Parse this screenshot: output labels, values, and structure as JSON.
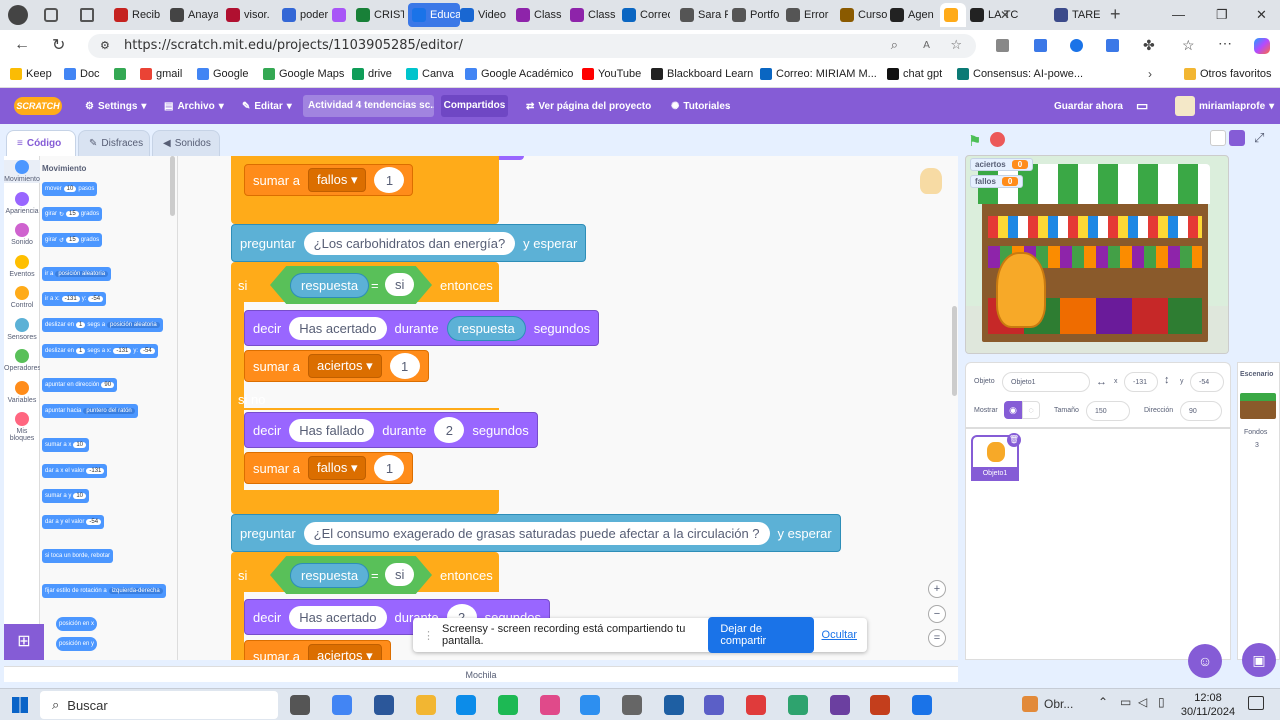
{
  "browser": {
    "tabs": [
      {
        "label": "Recib",
        "color": "#c5221f"
      },
      {
        "label": "Anaya",
        "color": "#444444"
      },
      {
        "label": "visor.",
        "color": "#b01030"
      },
      {
        "label": "poder",
        "color": "#3367d6"
      },
      {
        "label": "",
        "color": "#a855f7"
      },
      {
        "label": "CRIST",
        "color": "#188038"
      },
      {
        "label": "Educal",
        "color": "#1a73e8"
      },
      {
        "label": "Video",
        "color": "#1967d2"
      },
      {
        "label": "Class",
        "color": "#8e24aa"
      },
      {
        "label": "Class",
        "color": "#8e24aa"
      },
      {
        "label": "Correo",
        "color": "#0a66c2"
      },
      {
        "label": "Sara F",
        "color": "#555555"
      },
      {
        "label": "Portfo",
        "color": "#555555"
      },
      {
        "label": "Error",
        "color": "#555555"
      },
      {
        "label": "Curso",
        "color": "#8a5a00"
      },
      {
        "label": "Agen",
        "color": "#222222"
      },
      {
        "label": "",
        "color": "#ffab19"
      },
      {
        "label": "LA TC",
        "color": "#222222"
      },
      {
        "label": "TARE",
        "color": "#3b4a8a"
      }
    ],
    "url": "https://scratch.mit.edu/projects/1103905285/editor/",
    "bookmarks": [
      {
        "label": "Keep",
        "color": "#fbbc04"
      },
      {
        "label": "Doc",
        "color": "#4285f4"
      },
      {
        "label": "",
        "color": "#34a853"
      },
      {
        "label": "gmail",
        "color": "#ea4335"
      },
      {
        "label": "Google",
        "color": "#4285f4"
      },
      {
        "label": "Google Maps",
        "color": "#34a853"
      },
      {
        "label": "drive",
        "color": "#0f9d58"
      },
      {
        "label": "Canva",
        "color": "#00c4cc"
      },
      {
        "label": "Google Académico",
        "color": "#4285f4"
      },
      {
        "label": "YouTube",
        "color": "#ff0000"
      },
      {
        "label": "Blackboard Learn",
        "color": "#222222"
      },
      {
        "label": "Correo: MIRIAM M...",
        "color": "#0a66c2"
      },
      {
        "label": "chat gpt",
        "color": "#111111"
      },
      {
        "label": "Consensus: AI-powe...",
        "color": "#0b7a75"
      }
    ],
    "other_bookmarks": "Otros favoritos"
  },
  "scratch": {
    "menu": {
      "settings": "Settings",
      "file": "Archivo",
      "edit": "Editar",
      "project_title": "Actividad 4 tendencias sc...",
      "shared": "Compartidos",
      "see_project": "Ver página del proyecto",
      "tutorials": "Tutoriales",
      "save": "Guardar ahora",
      "user": "miriamlaprofe",
      "logo": "SCRATCH"
    },
    "tabs": {
      "code": "Código",
      "costumes": "Disfraces",
      "sounds": "Sonidos"
    },
    "categories": [
      {
        "label": "Movimiento",
        "color": "#4c97ff"
      },
      {
        "label": "Apariencia",
        "color": "#9966ff"
      },
      {
        "label": "Sonido",
        "color": "#cf63cf"
      },
      {
        "label": "Eventos",
        "color": "#ffbf00"
      },
      {
        "label": "Control",
        "color": "#ffab19"
      },
      {
        "label": "Sensores",
        "color": "#5cb1d6"
      },
      {
        "label": "Operadores",
        "color": "#59c059"
      },
      {
        "label": "Variables",
        "color": "#ff8c1a"
      },
      {
        "label": "Mis bloques",
        "color": "#ff6680"
      }
    ],
    "palette": {
      "heading": "Movimiento",
      "blocks": {
        "move_a": "mover",
        "move_b": "10",
        "move_c": "pasos",
        "turn_r_a": "girar",
        "turn_r_b": "15",
        "turn_r_c": "grados",
        "turn_l_a": "girar",
        "turn_l_b": "15",
        "turn_l_c": "grados",
        "goto_a": "ir a",
        "goto_b": "posición aleatoria",
        "gotoxy_a": "ir a x:",
        "gotoxy_b": "-131",
        "gotoxy_c": "y:",
        "gotoxy_d": "-54",
        "glide_a": "deslizar en",
        "glide_b": "1",
        "glide_c": "segs a",
        "glide_d": "posición aleatoria",
        "glidexy_a": "deslizar en",
        "glidexy_b": "1",
        "glidexy_c": "segs a x:",
        "glidexy_d": "-131",
        "glidexy_e": "y:",
        "glidexy_f": "-54",
        "point_a": "apuntar en dirección",
        "point_b": "90",
        "towards_a": "apuntar hacia",
        "towards_b": "puntero del ratón",
        "changex_a": "sumar a x",
        "changex_b": "10",
        "setx_a": "dar a x el valor",
        "setx_b": "-131",
        "changey_a": "sumar a y",
        "changey_b": "10",
        "sety_a": "dar a y el valor",
        "sety_b": "-54",
        "bounce": "si toca un borde, rebotar",
        "rot_a": "fijar estilo de rotación a",
        "rot_b": "izquierda-derecha",
        "posx": "posición en x",
        "posy": "posición en y"
      }
    },
    "script": {
      "sumar": "sumar a",
      "fallos": "fallos",
      "aciertos": "aciertos",
      "one": "1",
      "two": "2",
      "preguntar": "preguntar",
      "esperar": "y esperar",
      "q1": "¿Los carbohidratos dan energía?",
      "q2": "¿El consumo exagerado de grasas saturadas puede afectar a la circulación ?",
      "si": "si",
      "entonces": "entonces",
      "respuesta": "respuesta",
      "eq": "=",
      "si_val": "si",
      "decir": "decir",
      "acertado": "Has acertado",
      "fallado": "Has fallado",
      "durante": "durante",
      "segundos": "segundos",
      "sino": "si no",
      "partial_two": "2"
    },
    "stage": {
      "monitors": [
        {
          "label": "aciertos",
          "value": "0"
        },
        {
          "label": "fallos",
          "value": "0"
        }
      ]
    },
    "sprite_info": {
      "sprite_label": "Objeto",
      "sprite_name": "Objeto1",
      "x_label": "x",
      "x": "-131",
      "y_label": "y",
      "y": "-54",
      "show_label": "Mostrar",
      "size_label": "Tamaño",
      "size": "150",
      "direction_label": "Dirección",
      "direction": "90"
    },
    "sprites": [
      {
        "name": "Objeto1"
      }
    ],
    "stage_panel": {
      "title": "Escenario",
      "backdrops_label": "Fondos",
      "backdrops_count": "3"
    },
    "backpack": "Mochila"
  },
  "share_bar": {
    "message": "Screensy - screen recording está compartiendo tu pantalla.",
    "stop_button": "Dejar de compartir",
    "hide_link": "Ocultar"
  },
  "taskbar": {
    "search": "Buscar",
    "weather": "Obr...",
    "time": "12:08",
    "date": "30/11/2024"
  }
}
